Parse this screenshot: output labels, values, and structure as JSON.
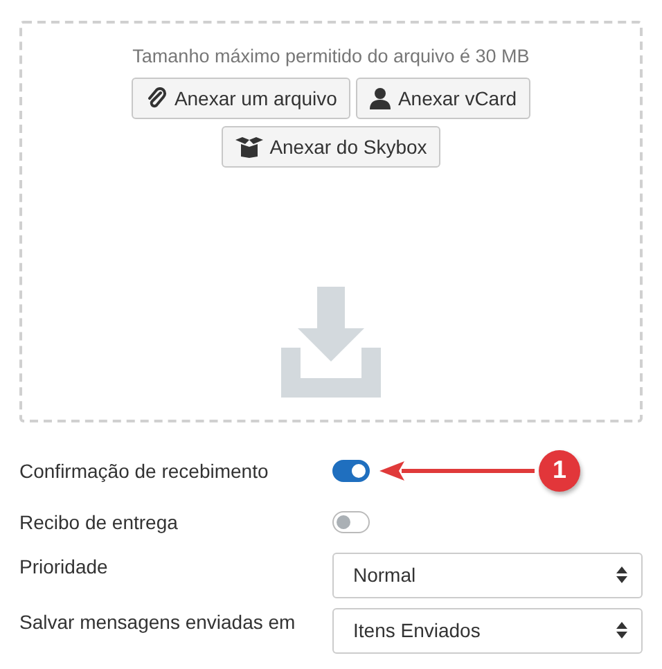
{
  "upload": {
    "limit_text": "Tamanho máximo permitido do arquivo é 30 MB",
    "buttons": [
      {
        "label": "Anexar um arquivo",
        "kind": "paperclip"
      },
      {
        "label": "Anexar vCard",
        "kind": "person"
      },
      {
        "label": "Anexar do Skybox",
        "kind": "box"
      }
    ]
  },
  "settings": [
    {
      "kind": "toggle",
      "label": "Confirmação de recebimento",
      "on": true
    },
    {
      "kind": "toggle",
      "label": "Recibo de entrega",
      "on": false
    },
    {
      "kind": "select",
      "label": "Prioridade",
      "value": "Normal"
    },
    {
      "kind": "select",
      "label": "Salvar mensagens enviadas em",
      "value": "Itens Enviados"
    }
  ],
  "annotation": {
    "badge": "1"
  }
}
